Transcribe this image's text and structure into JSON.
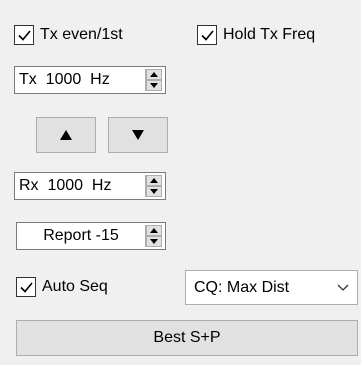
{
  "checkboxes": {
    "tx_even": {
      "label": "Tx even/1st",
      "checked": true
    },
    "hold_tx_freq": {
      "label": "Hold Tx Freq",
      "checked": true
    },
    "auto_seq": {
      "label": "Auto Seq",
      "checked": true
    }
  },
  "tx_spin": {
    "value": "Tx  1000  Hz"
  },
  "rx_spin": {
    "value": "Rx  1000  Hz"
  },
  "report_spin": {
    "value": "Report -15"
  },
  "buttons": {
    "up_icon": "triangle-up",
    "down_icon": "triangle-down",
    "best_sp": "Best S+P"
  },
  "cq_combo": {
    "selected": "CQ: Max Dist"
  }
}
